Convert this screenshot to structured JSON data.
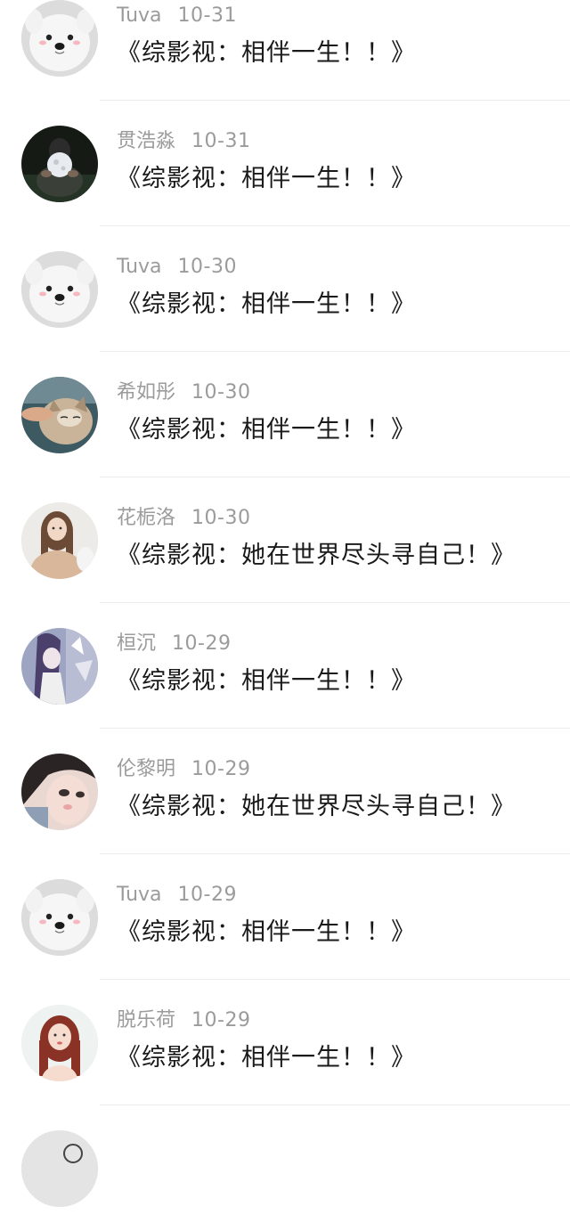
{
  "comments": [
    {
      "user": "Tuva",
      "date": "10-31",
      "text": "《综影视：相伴一生！！》",
      "avatar": "samoyed-avatar"
    },
    {
      "user": "贯浩淼",
      "date": "10-31",
      "text": "《综影视：相伴一生！！》",
      "avatar": "moon-hands-avatar"
    },
    {
      "user": "Tuva",
      "date": "10-30",
      "text": "《综影视：相伴一生！！》",
      "avatar": "samoyed-avatar"
    },
    {
      "user": "希如彤",
      "date": "10-30",
      "text": "《综影视：相伴一生！！》",
      "avatar": "cat-avatar"
    },
    {
      "user": "花栀洛",
      "date": "10-30",
      "text": "《综影视：她在世界尽头寻自己！》",
      "avatar": "girl-avatar"
    },
    {
      "user": "桓沉",
      "date": "10-29",
      "text": "《综影视：相伴一生！！》",
      "avatar": "anime-avatar"
    },
    {
      "user": "伦黎明",
      "date": "10-29",
      "text": "《综影视：她在世界尽头寻自己！》",
      "avatar": "illustration-avatar"
    },
    {
      "user": "Tuva",
      "date": "10-29",
      "text": "《综影视：相伴一生！！》",
      "avatar": "samoyed-avatar"
    },
    {
      "user": "脱乐荷",
      "date": "10-29",
      "text": "《综影视：相伴一生！！》",
      "avatar": "red-hair-girl-avatar"
    },
    {
      "user": "",
      "date": "",
      "text": "",
      "avatar": "partial-avatar"
    }
  ]
}
